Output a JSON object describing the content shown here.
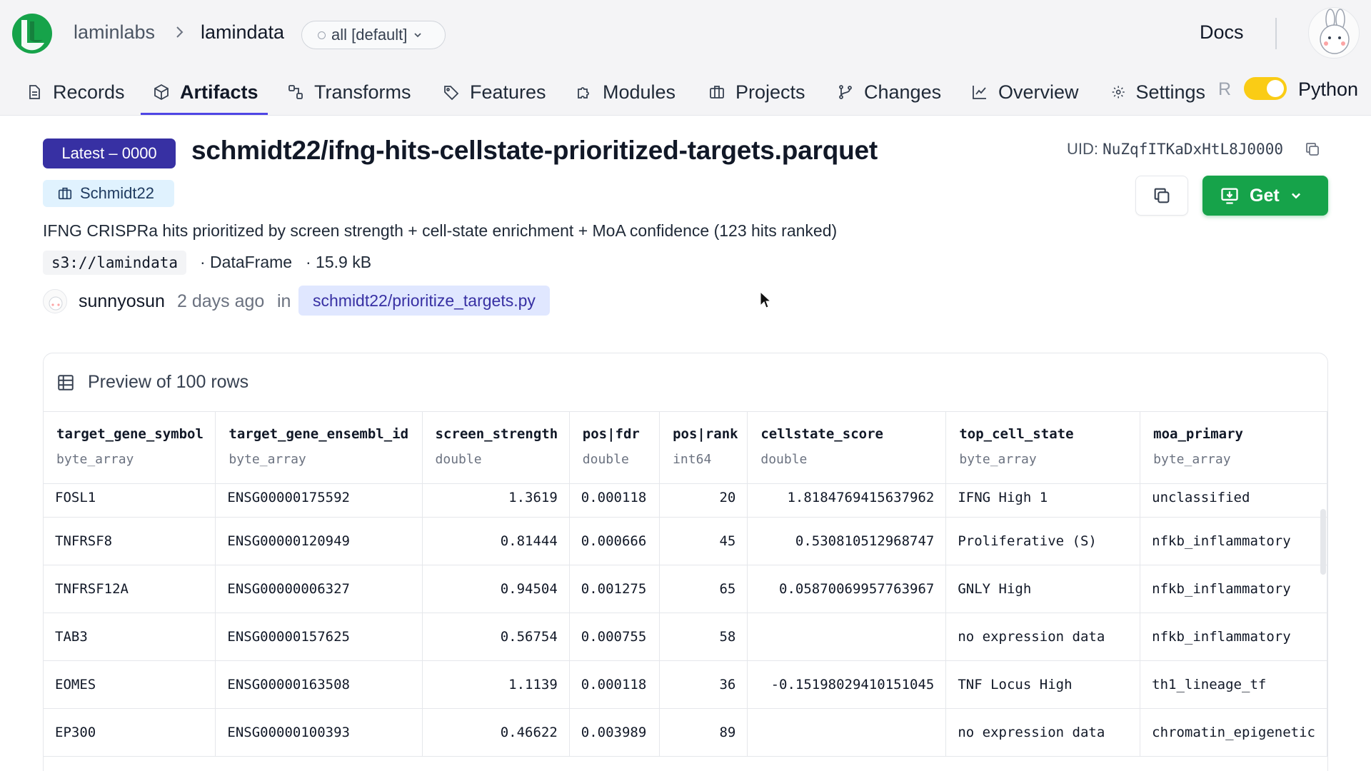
{
  "header": {
    "org": "laminlabs",
    "instance": "lamindata",
    "branch": "all [default]",
    "docs_label": "Docs"
  },
  "nav": {
    "items": [
      {
        "label": "Records",
        "icon": "file-text-icon"
      },
      {
        "label": "Artifacts",
        "icon": "box-icon",
        "active": true
      },
      {
        "label": "Transforms",
        "icon": "transform-icon"
      },
      {
        "label": "Features",
        "icon": "tag-icon"
      },
      {
        "label": "Modules",
        "icon": "puzzle-icon"
      },
      {
        "label": "Projects",
        "icon": "briefcase-icon"
      },
      {
        "label": "Changes",
        "icon": "git-branch-icon"
      },
      {
        "label": "Overview",
        "icon": "chart-icon"
      },
      {
        "label": "Settings",
        "icon": "gear-icon"
      }
    ],
    "toggle_left": "R",
    "toggle_right": "Python",
    "toggle_on": true
  },
  "artifact": {
    "version_badge": "Latest – 0000",
    "title": "schmidt22/ifng-hits-cellstate-prioritized-targets.parquet",
    "uid_label": "UID:",
    "uid": "NuZqfITKaDxHtL8J0000",
    "project": "Schmidt22",
    "description": "IFNG CRISPRa hits prioritized by screen strength + cell-state enrichment + MoA confidence (123 hits ranked)",
    "storage": "s3://lamindata",
    "otype": "· DataFrame",
    "size": "· 15.9 kB",
    "created_by": "sunnyosun",
    "created_when": "2 days ago",
    "in_label": "in",
    "transform": "schmidt22/prioritize_targets.py",
    "get_label": "Get"
  },
  "preview": {
    "title": "Preview of 100 rows",
    "columns": [
      {
        "name": "target_gene_symbol",
        "dtype": "byte_array"
      },
      {
        "name": "target_gene_ensembl_id",
        "dtype": "byte_array"
      },
      {
        "name": "screen_strength",
        "dtype": "double"
      },
      {
        "name": "pos|fdr",
        "dtype": "double"
      },
      {
        "name": "pos|rank",
        "dtype": "int64"
      },
      {
        "name": "cellstate_score",
        "dtype": "double"
      },
      {
        "name": "top_cell_state",
        "dtype": "byte_array"
      },
      {
        "name": "moa_primary",
        "dtype": "byte_array"
      }
    ],
    "rows": [
      [
        "FOSL1",
        "ENSG00000175592",
        "1.3619",
        "0.000118",
        "20",
        "1.8184769415637962",
        "IFNG High 1",
        "unclassified"
      ],
      [
        "TNFRSF8",
        "ENSG00000120949",
        "0.81444",
        "0.000666",
        "45",
        "0.530810512968747",
        "Proliferative (S)",
        "nfkb_inflammatory"
      ],
      [
        "TNFRSF12A",
        "ENSG00000006327",
        "0.94504",
        "0.001275",
        "65",
        "0.05870069957763967",
        "GNLY High",
        "nfkb_inflammatory"
      ],
      [
        "TAB3",
        "ENSG00000157625",
        "0.56754",
        "0.000755",
        "58",
        "",
        "no expression data",
        "nfkb_inflammatory"
      ],
      [
        "EOMES",
        "ENSG00000163508",
        "1.1139",
        "0.000118",
        "36",
        "-0.15198029410151045",
        "TNF Locus High",
        "th1_lineage_tf"
      ],
      [
        "EP300",
        "ENSG00000100393",
        "0.46622",
        "0.003989",
        "89",
        "",
        "no expression data",
        "chromatin_epigenetic"
      ]
    ]
  },
  "colors": {
    "accent": "#4f46e5",
    "badge": "#3730a3",
    "get_button": "#16a34a",
    "toggle": "#facc15",
    "logo": "#16a34a"
  }
}
